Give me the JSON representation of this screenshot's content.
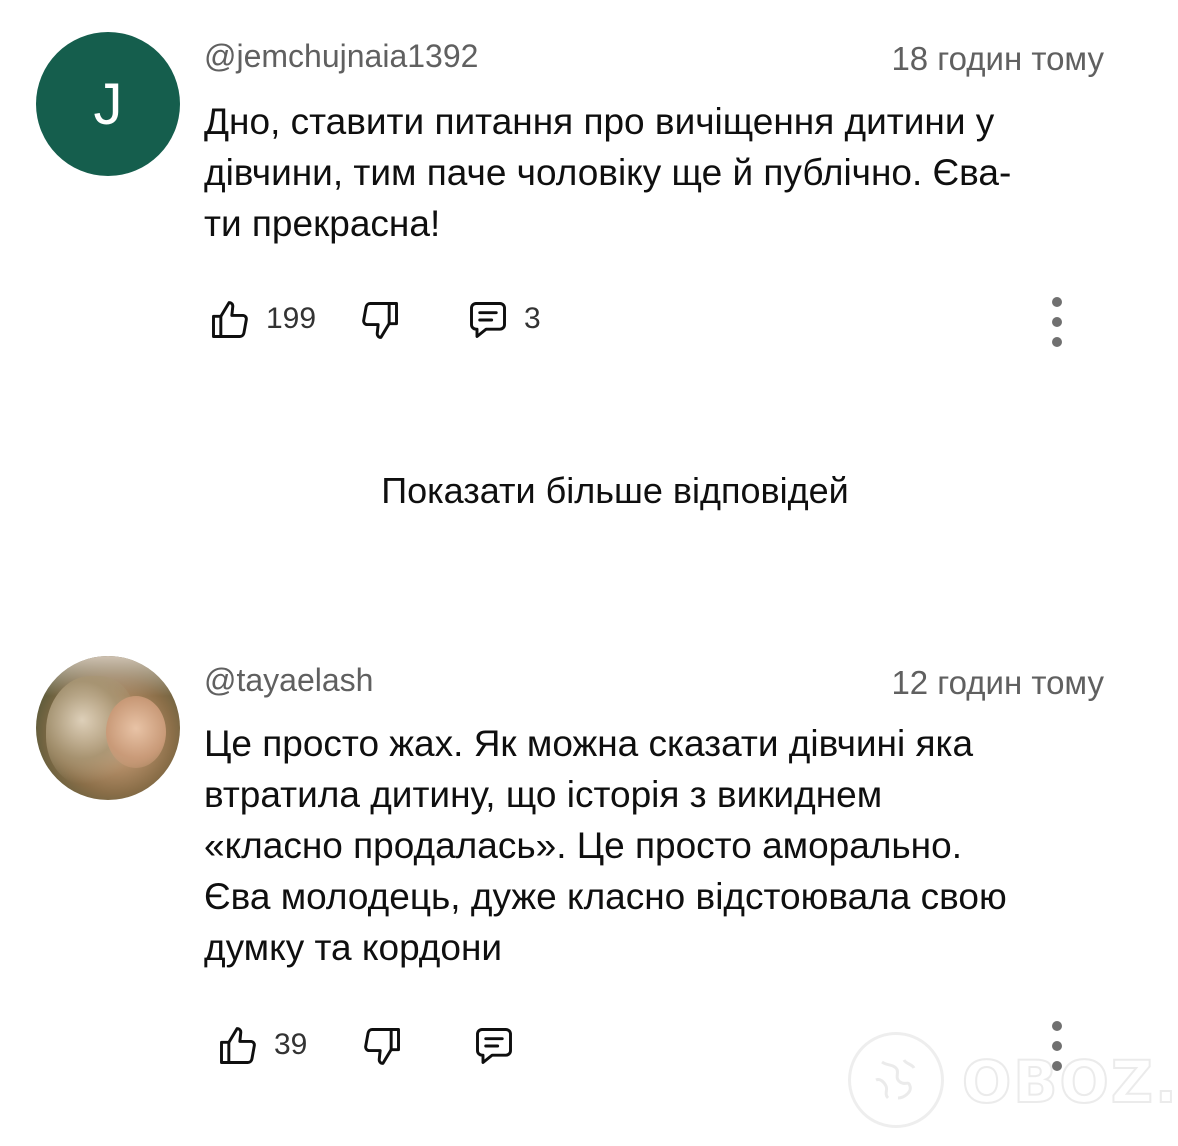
{
  "comments": [
    {
      "avatar_letter": "J",
      "avatar_color": "#155e4d",
      "username": "@jemchujnaia1392",
      "timestamp": "18 годин тому",
      "text_lines": [
        "Дно, ставити  питання про вичіщення дитини у",
        "дівчини, тим паче чоловіку ще й публічно. Єва-",
        "ти прекрасна!"
      ],
      "likes": "199",
      "replies": "3"
    },
    {
      "username": "@tayaelash",
      "timestamp": "12 годин тому",
      "text_lines": [
        "Це просто жах. Як можна сказати дівчині яка",
        "втратила дитину, що історія з викиднем",
        "«класно продалась». Це просто аморально.",
        "Єва молодець, дуже класно відстоювала свою",
        "думку та кордони"
      ],
      "likes": "39"
    }
  ],
  "show_more_replies": "Показати більше відповідей",
  "watermark": {
    "text": "OBOZ.UA"
  },
  "icons": {
    "like": "thumbs-up-icon",
    "dislike": "thumbs-down-icon",
    "reply": "comment-icon",
    "more": "more-vertical-icon"
  }
}
